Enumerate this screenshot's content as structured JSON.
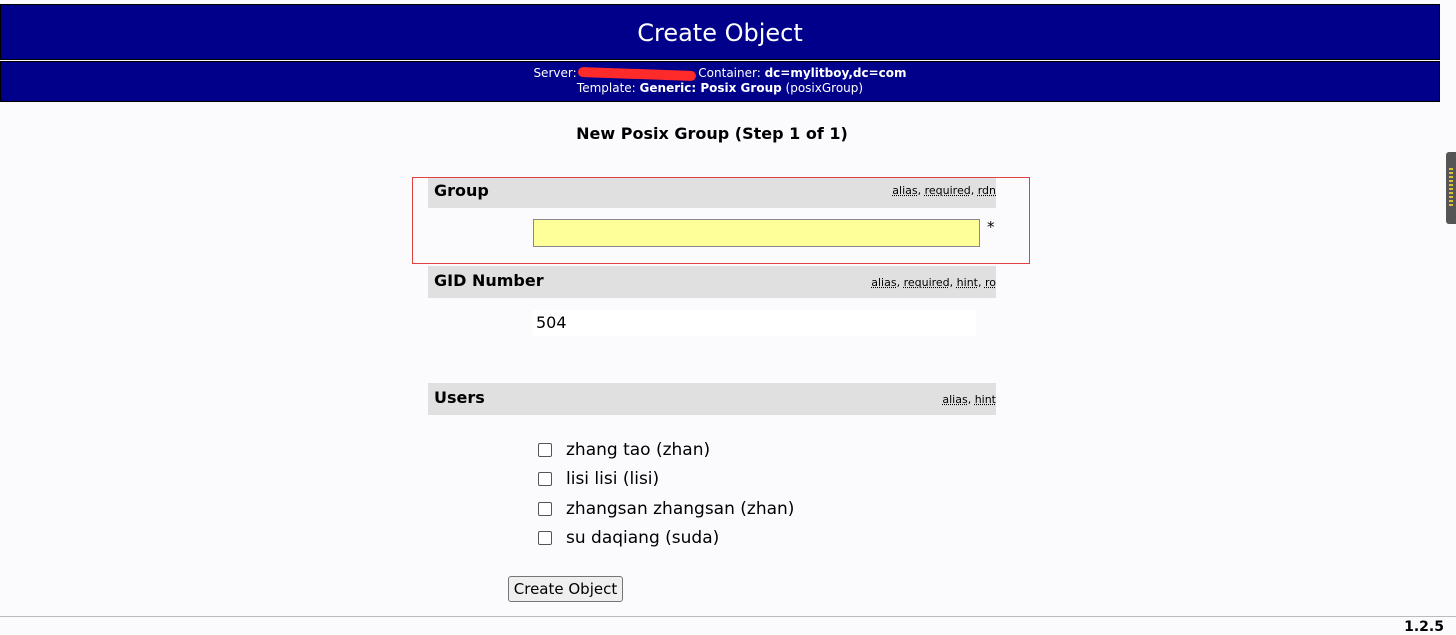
{
  "header": {
    "title": "Create Object",
    "server_label": "Server:",
    "container_label": "Container:",
    "container_value": "dc=mylitboy,dc=com",
    "template_label": "Template:",
    "template_value": "Generic: Posix Group",
    "template_schema": "(posixGroup)"
  },
  "form": {
    "title": "New Posix Group (Step 1 of 1)",
    "group": {
      "label": "Group",
      "flag_alias": "alias",
      "flag_required": "required",
      "flag_rdn": "rdn",
      "value": "",
      "required_mark": "*"
    },
    "gid": {
      "label": "GID Number",
      "flag_alias": "alias",
      "flag_required": "required",
      "flag_hint": "hint",
      "flag_ro": "ro",
      "value": "504"
    },
    "users": {
      "label": "Users",
      "flag_alias": "alias",
      "flag_hint": "hint",
      "items": [
        {
          "label": "zhang tao (zhan)",
          "checked": false
        },
        {
          "label": "lisi lisi (lisi)",
          "checked": false
        },
        {
          "label": "zhangsan zhangsan (zhan)",
          "checked": false
        },
        {
          "label": "su daqiang (suda)",
          "checked": false
        }
      ]
    },
    "submit_label": "Create Object"
  },
  "footer": {
    "version": "1.2.5"
  },
  "colors": {
    "header_bg": "#00008b",
    "input_bg": "#ffff99",
    "highlight_border": "#e04040"
  }
}
